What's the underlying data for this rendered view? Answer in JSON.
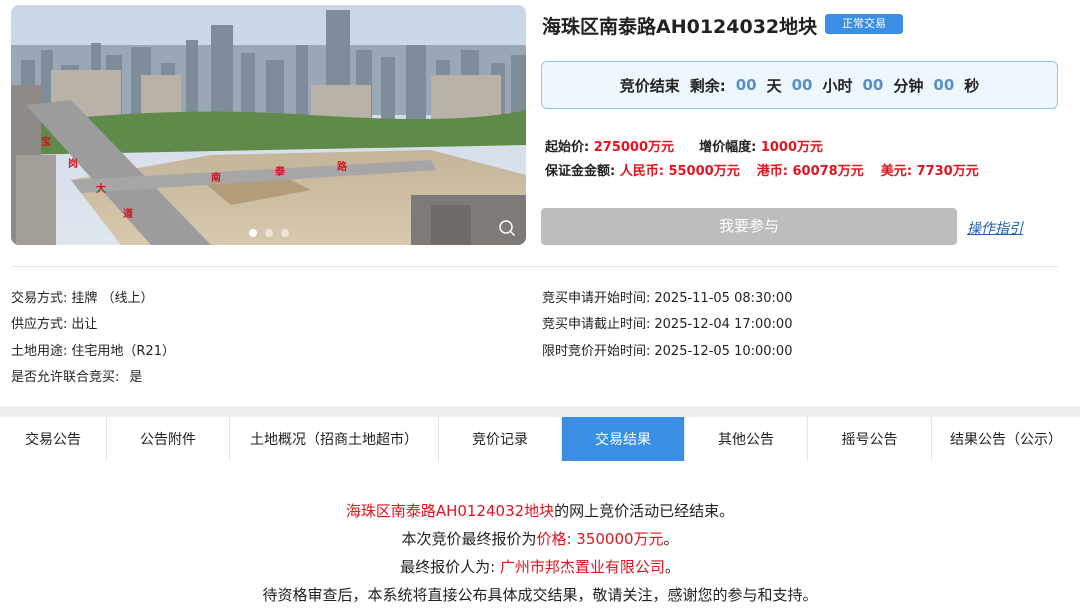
{
  "photo": {
    "road_label_left": [
      "宝",
      "岗",
      "大",
      "道"
    ],
    "road_label_bottom": [
      "南",
      "泰",
      "路"
    ],
    "dots_count": 3,
    "active_dot": 0
  },
  "header": {
    "title": "海珠区南泰路AH0124032地块",
    "status_badge": "正常交易"
  },
  "countdown": {
    "label": "竞价结束",
    "remaining_label": "剩余:",
    "days": "00",
    "days_unit": "天",
    "hours": "00",
    "hours_unit": "小时",
    "minutes": "00",
    "minutes_unit": "分钟",
    "seconds": "00",
    "seconds_unit": "秒"
  },
  "price": {
    "start_price_label": "起始价:",
    "start_price": "275000万元",
    "increment_label": "增价幅度:",
    "increment": "1000万元",
    "deposit_label": "保证金金额:",
    "rmb_label": "人民币:",
    "rmb": "55000万元",
    "hkd_label": "港币:",
    "hkd": "60078万元",
    "usd_label": "美元:",
    "usd": "7730万元"
  },
  "actions": {
    "join_button": "我要参与",
    "guide_link": "操作指引"
  },
  "info_left": [
    {
      "label": "交易方式:",
      "value": "挂牌 （线上）"
    },
    {
      "label": "供应方式:",
      "value": "出让"
    },
    {
      "label": "土地用途:",
      "value": "住宅用地（R21）"
    },
    {
      "label": "是否允许联合竞买:",
      "value": "是"
    }
  ],
  "info_right": [
    {
      "label": "竞买申请开始时间:",
      "value": "2025-11-05 08:30:00"
    },
    {
      "label": "竞买申请截止时间:",
      "value": "2025-12-04 17:00:00"
    },
    {
      "label": "限时竞价开始时间:",
      "value": "2025-12-05 10:00:00"
    }
  ],
  "tabs": [
    {
      "label": "交易公告"
    },
    {
      "label": "公告附件"
    },
    {
      "label": "土地概况（招商土地超市）"
    },
    {
      "label": "竞价记录"
    },
    {
      "label": "交易结果"
    },
    {
      "label": "其他公告"
    },
    {
      "label": "摇号公告"
    },
    {
      "label": "结果公告（公示）"
    }
  ],
  "active_tab": "交易结果",
  "result": {
    "line1_red": "海珠区南泰路AH0124032地块",
    "line1_rest": "的网上竞价活动已经结束。",
    "line2_prefix": "本次竞价最终报价为",
    "line2_red": "价格:  350000万元",
    "line2_suffix": "。",
    "line3_prefix": "最终报价人为:  ",
    "line3_red": "广州市邦杰置业有限公司",
    "line3_suffix": "。",
    "line4": "待资格审查后，本系统将直接公布具体成交结果，敬请关注，感谢您的参与和支持。"
  },
  "colors": {
    "accent_blue": "#3a8ee6",
    "price_red": "#e0141e",
    "countdown_num": "#5a8fc6",
    "link_blue": "#1a5fb4"
  }
}
